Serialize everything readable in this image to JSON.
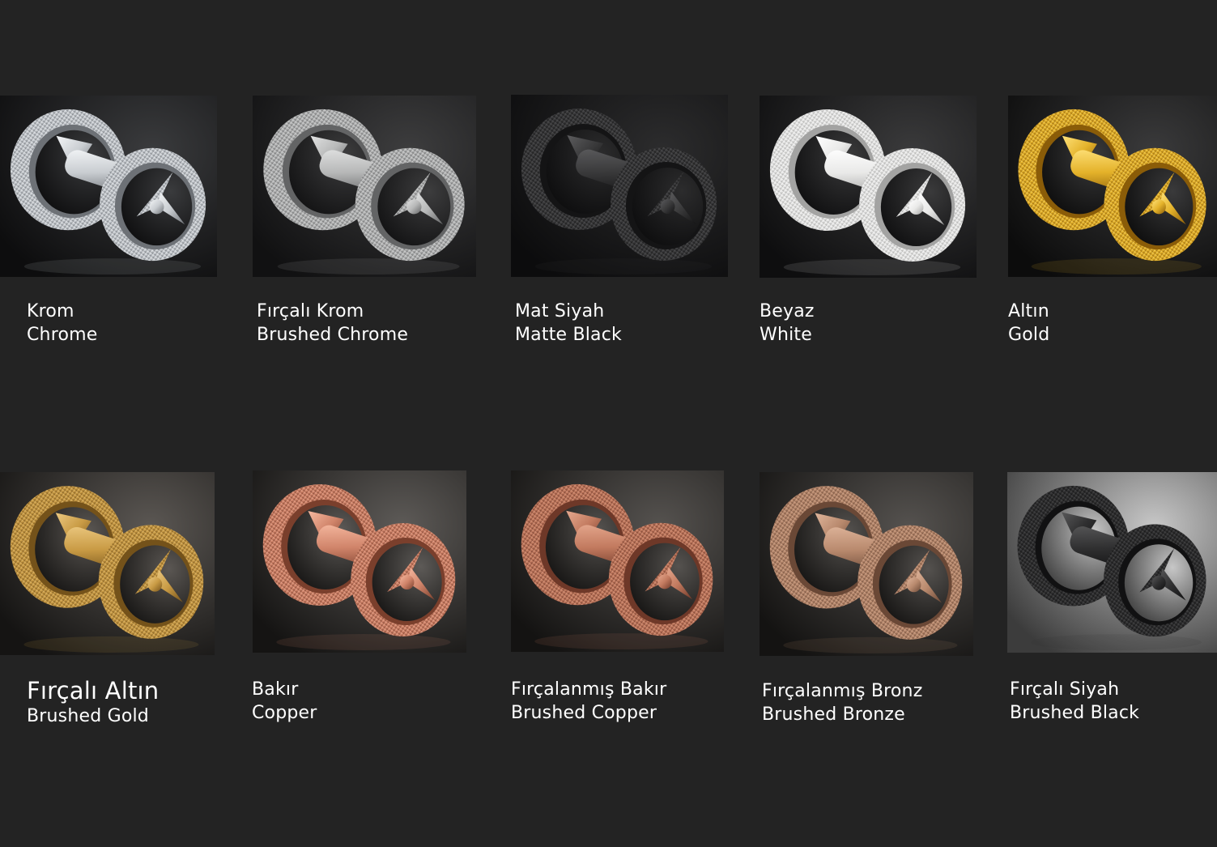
{
  "finishes": [
    {
      "tr": "Krom",
      "en": "Chrome",
      "ring": "#c9cdd1",
      "ring_dark": "#6d7176",
      "ring_light": "#f4f6f8",
      "bg1": "#3a3b3d",
      "bg2": "#0d0d0e",
      "icon": "chrome-knob-icon"
    },
    {
      "tr": "Fırçalı Krom",
      "en": "Brushed Chrome",
      "ring": "#b7b8b8",
      "ring_dark": "#636465",
      "ring_light": "#e1e2e2",
      "bg1": "#3d3d3e",
      "bg2": "#111112",
      "icon": "brushed-chrome-knob-icon"
    },
    {
      "tr": "Mat Siyah",
      "en": "Matte Black",
      "ring": "#3a3a3b",
      "ring_dark": "#141415",
      "ring_light": "#5c5c5e",
      "bg1": "#2c2c2d",
      "bg2": "#0c0c0d",
      "icon": "matte-black-knob-icon"
    },
    {
      "tr": "Beyaz",
      "en": "White",
      "ring": "#e9e9e8",
      "ring_dark": "#a3a3a2",
      "ring_light": "#ffffff",
      "bg1": "#3a3a3b",
      "bg2": "#0e0e0f",
      "icon": "white-knob-icon"
    },
    {
      "tr": "Altın",
      "en": "Gold",
      "ring": "#e4b22a",
      "ring_dark": "#8a5c08",
      "ring_light": "#ffe27a",
      "bg1": "#3a3a3b",
      "bg2": "#0c0c0c",
      "icon": "gold-knob-icon"
    },
    {
      "tr": "Fırçalı Altın",
      "en": "Brushed Gold",
      "ring": "#c99b45",
      "ring_dark": "#74521a",
      "ring_light": "#ecc981",
      "bg1": "#5b5753",
      "bg2": "#151413",
      "icon": "brushed-gold-knob-icon",
      "big": true
    },
    {
      "tr": "Bakır",
      "en": "Copper",
      "ring": "#d0846a",
      "ring_dark": "#7a3f2c",
      "ring_light": "#f6b9a0",
      "bg1": "#5d5a57",
      "bg2": "#151413",
      "icon": "copper-knob-icon"
    },
    {
      "tr": "Fırçalanmış Bakır",
      "en": "Brushed Copper",
      "ring": "#c27a5f",
      "ring_dark": "#6e3828",
      "ring_light": "#e6a98f",
      "bg1": "#55524f",
      "bg2": "#141312",
      "icon": "brushed-copper-knob-icon"
    },
    {
      "tr": "Fırçalanmış Bronz",
      "en": "Brushed Bronze",
      "ring": "#b98a6e",
      "ring_dark": "#6a4836",
      "ring_light": "#dfb59b",
      "bg1": "#55524f",
      "bg2": "#141312",
      "icon": "brushed-bronze-knob-icon"
    },
    {
      "tr": "Fırçalı Siyah",
      "en": "Brushed Black",
      "ring": "#2f2f30",
      "ring_dark": "#111112",
      "ring_light": "#585859",
      "bg1": "#c7c7c7",
      "bg2": "#3c3c3c",
      "icon": "brushed-black-knob-icon"
    }
  ]
}
